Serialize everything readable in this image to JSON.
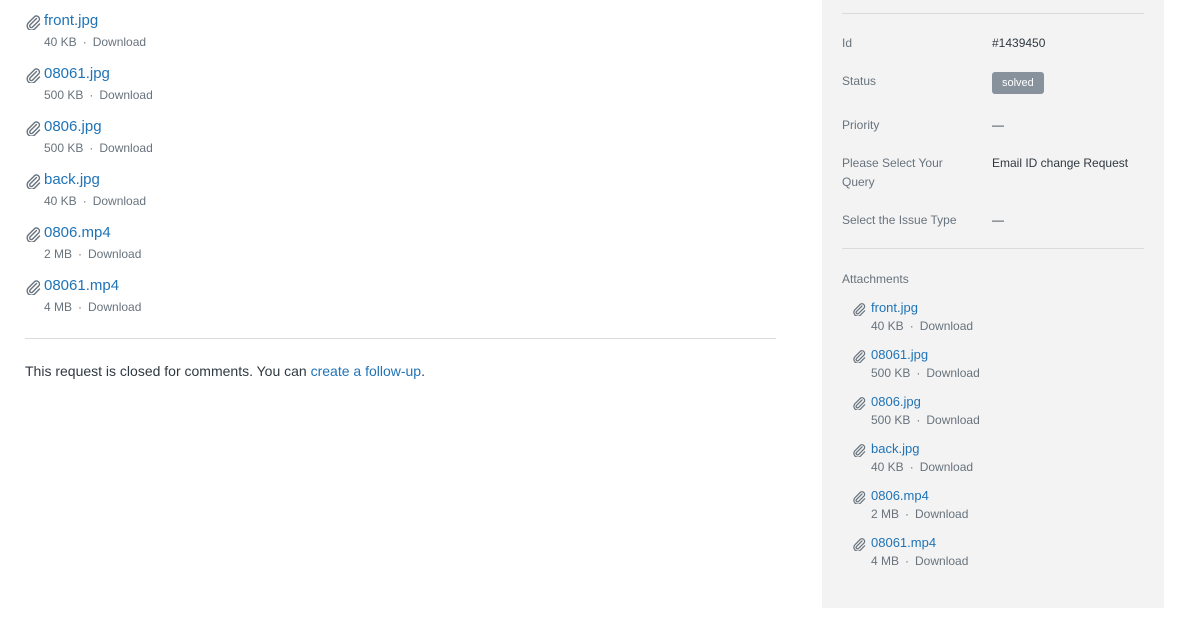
{
  "main": {
    "attachments": [
      {
        "name": "front.jpg",
        "size": "40 KB",
        "download": "Download"
      },
      {
        "name": "08061.jpg",
        "size": "500 KB",
        "download": "Download"
      },
      {
        "name": "0806.jpg",
        "size": "500 KB",
        "download": "Download"
      },
      {
        "name": "back.jpg",
        "size": "40 KB",
        "download": "Download"
      },
      {
        "name": "0806.mp4",
        "size": "2 MB",
        "download": "Download"
      },
      {
        "name": "08061.mp4",
        "size": "4 MB",
        "download": "Download"
      }
    ],
    "separator": "·",
    "closed_text_before": "This request is closed for comments. You can ",
    "closed_link": "create a follow-up",
    "closed_text_after": "."
  },
  "sidebar": {
    "id_label": "Id",
    "id_value": "#1439450",
    "status_label": "Status",
    "status_value": "solved",
    "priority_label": "Priority",
    "priority_value": "—",
    "query_label": "Please Select Your Query",
    "query_value": "Email ID change Request",
    "issue_type_label": "Select the Issue Type",
    "issue_type_value": "—",
    "attachments_title": "Attachments",
    "attachments": [
      {
        "name": "front.jpg",
        "size": "40 KB",
        "download": "Download"
      },
      {
        "name": "08061.jpg",
        "size": "500 KB",
        "download": "Download"
      },
      {
        "name": "0806.jpg",
        "size": "500 KB",
        "download": "Download"
      },
      {
        "name": "back.jpg",
        "size": "40 KB",
        "download": "Download"
      },
      {
        "name": "0806.mp4",
        "size": "2 MB",
        "download": "Download"
      },
      {
        "name": "08061.mp4",
        "size": "4 MB",
        "download": "Download"
      }
    ]
  },
  "colors": {
    "link": "#1f73b7",
    "muted_text": "#68737d",
    "sidebar_bg": "#f3f3f3",
    "badge_bg": "#87929d"
  },
  "icons": {
    "attachment": "paperclip-icon"
  }
}
